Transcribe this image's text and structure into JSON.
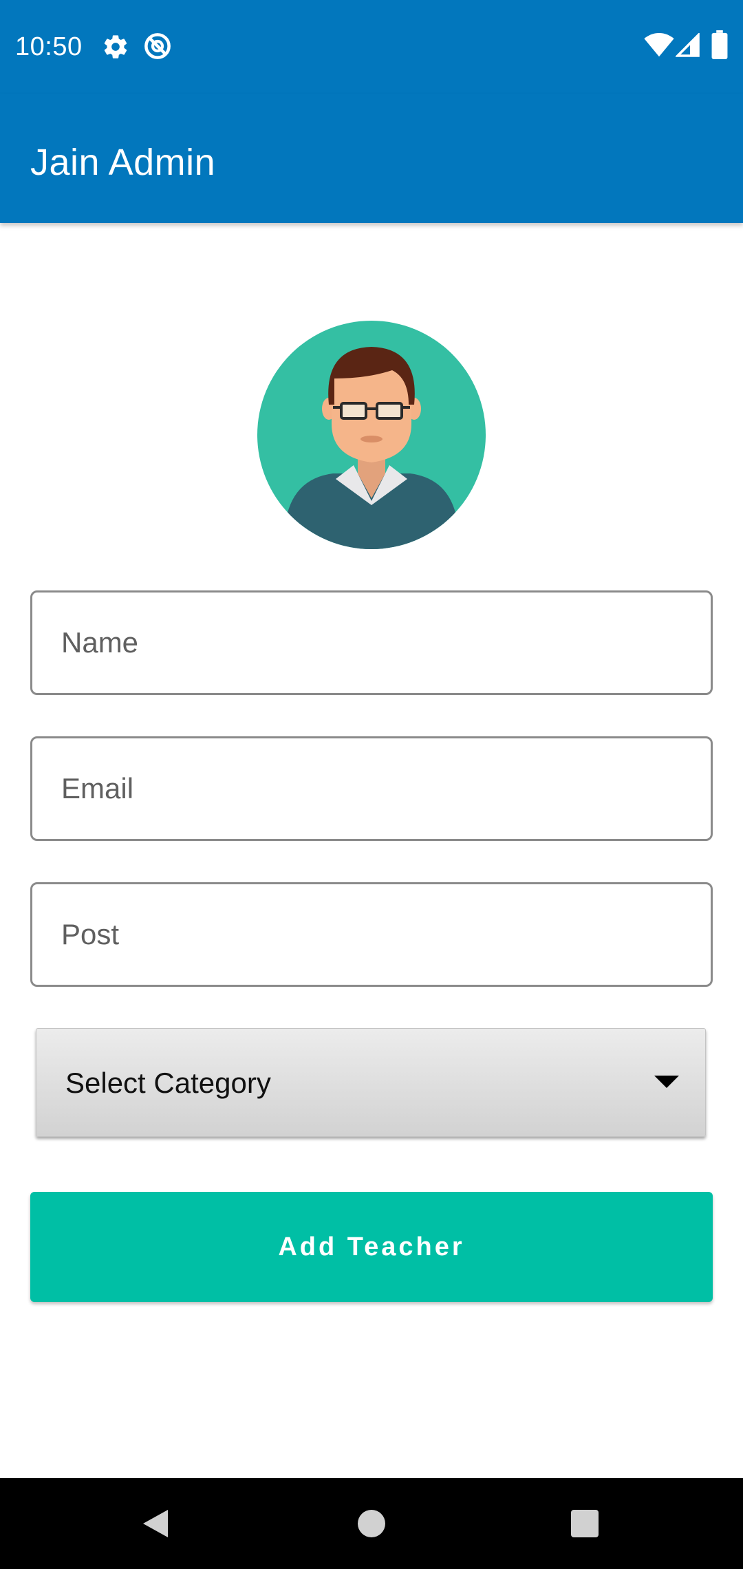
{
  "status_bar": {
    "time": "10:50",
    "icons": [
      "settings-gear-icon",
      "at-sign-icon",
      "wifi-icon",
      "cellular-signal-icon",
      "battery-icon"
    ]
  },
  "app_bar": {
    "title": "Jain Admin",
    "color": "#0277bd"
  },
  "avatar": {
    "icon": "teacher-avatar-icon",
    "background": "#34bfa3"
  },
  "form": {
    "name": {
      "placeholder": "Name",
      "value": ""
    },
    "email": {
      "placeholder": "Email",
      "value": ""
    },
    "post": {
      "placeholder": "Post",
      "value": ""
    },
    "category": {
      "selected": "Select Category"
    },
    "submit_label": "Add Teacher",
    "accent": "#00bfa5"
  },
  "nav_bar": {
    "buttons": [
      "back-icon",
      "home-icon",
      "recents-icon"
    ]
  }
}
